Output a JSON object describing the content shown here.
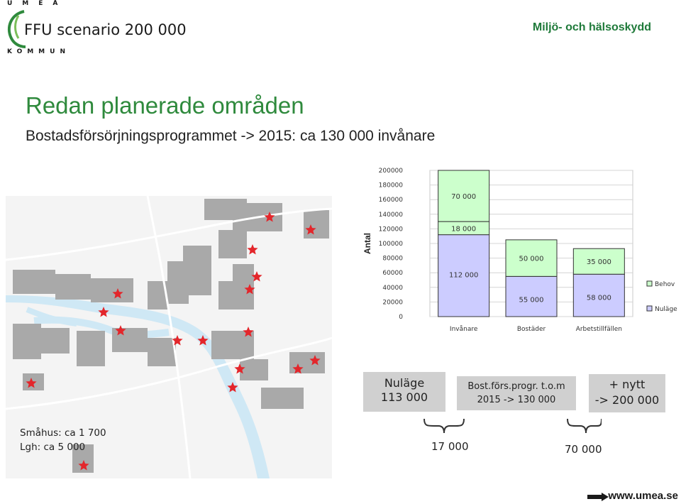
{
  "header": {
    "logo_top": "UMEÅ",
    "logo_bottom": "KOMMUN",
    "logo_text": "FFU scenario 200 000",
    "department": "Miljö- och hälsoskydd"
  },
  "slide": {
    "title": "Redan planerade områden",
    "subtitle": "Bostadsförsörjningsprogrammet -> 2015: ca 130 000 invånare"
  },
  "map": {
    "note_line1": "Småhus: ca 1 700",
    "note_line2": "Lgh: ca 5 000",
    "water_color": "#cfe8f5",
    "building_color": "#a9a9a9",
    "star_color": "#e3262b"
  },
  "summary": {
    "box1_line1": "Nuläge",
    "box1_line2": "113 000",
    "box2_line1": "Bost.förs.progr. t.o.m",
    "box2_line2": "2015 -> 130 000",
    "box3_line1": "+ nytt",
    "box3_line2": "-> 200 000",
    "brace1_value": "17 000",
    "brace2_value": "70 000"
  },
  "footer": {
    "url": "www.umea.se"
  },
  "chart_data": {
    "type": "bar",
    "stacked": true,
    "categories": [
      "Invånare",
      "Bostäder",
      "Arbetstillfällen"
    ],
    "series": [
      {
        "name": "Nuläge",
        "color": "#ccccff",
        "values": [
          112000,
          55000,
          58000
        ],
        "labels": [
          "112 000",
          "55 000",
          "58 000"
        ]
      },
      {
        "name": "",
        "color": "#ccffcc",
        "values": [
          18000,
          0,
          0
        ],
        "labels": [
          "18 000",
          "",
          ""
        ]
      },
      {
        "name": "Behov",
        "color": "#ccffcc",
        "values": [
          70000,
          50000,
          35000
        ],
        "labels": [
          "70 000",
          "50 000",
          "35 000"
        ]
      }
    ],
    "ylabel": "Antal",
    "ylim": [
      0,
      200000
    ],
    "yticks": [
      0,
      20000,
      40000,
      60000,
      80000,
      100000,
      120000,
      140000,
      160000,
      180000,
      200000
    ],
    "legend": [
      "Behov",
      "Nuläge"
    ],
    "legend_position": "right",
    "grid": true
  }
}
